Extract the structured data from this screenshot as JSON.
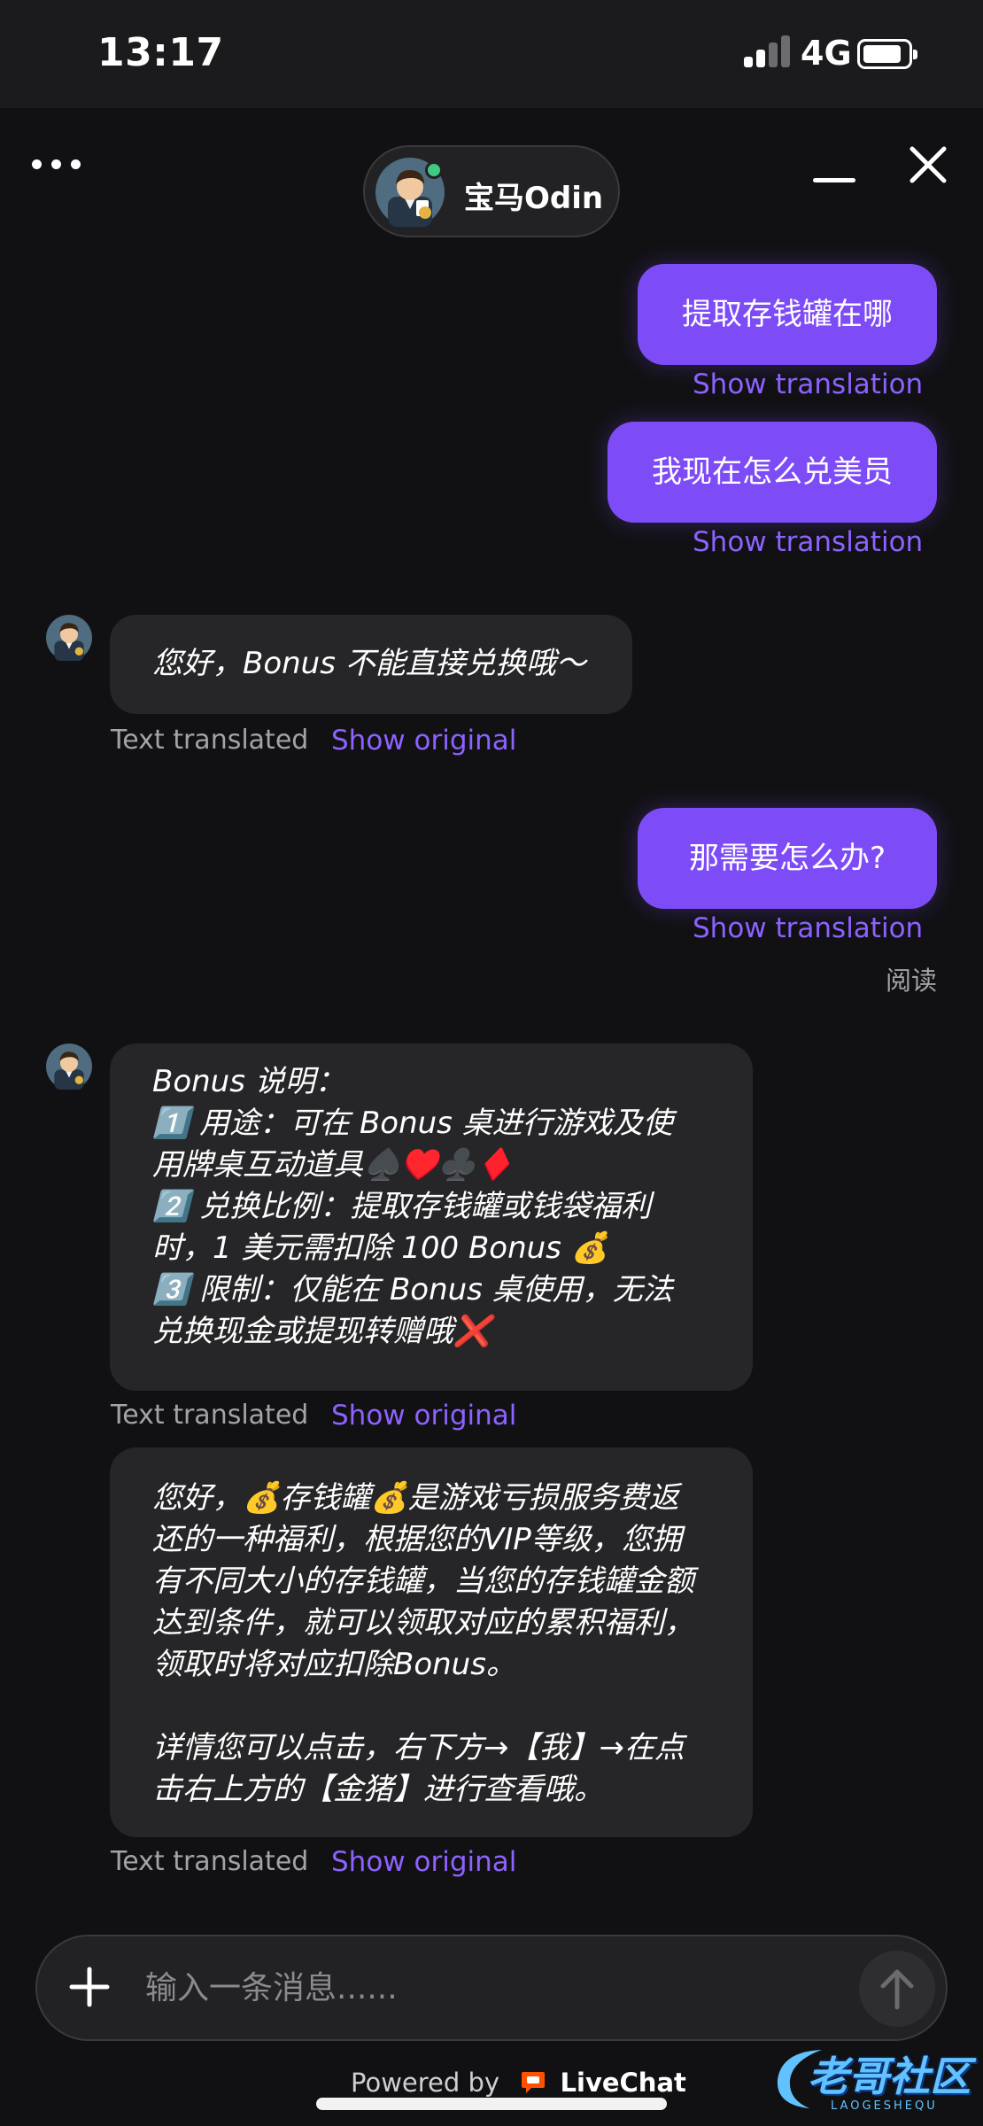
{
  "status_bar": {
    "time": "13:17",
    "network": "4G"
  },
  "header": {
    "agent_name": "宝马Odin"
  },
  "conversation": {
    "out1": {
      "text": "提取存钱罐在哪",
      "link": "Show translation"
    },
    "out2": {
      "text": "我现在怎么兑美员",
      "link": "Show translation"
    },
    "in1": {
      "lines": [
        "您好，Bonus 不能直接兑换哦～"
      ],
      "meta": "Text translated",
      "link": "Show original"
    },
    "out3": {
      "text": "那需要怎么办?",
      "link": "Show translation",
      "receipt": "阅读"
    },
    "in2": {
      "lines": [
        "Bonus 说明：",
        "1️⃣ 用途：可在 Bonus 桌进行游戏及使",
        "用牌桌互动道具♠️♥️♣️♦️",
        "2️⃣ 兑换比例：提取存钱罐或钱袋福利",
        "时，1 美元需扣除 100 Bonus 💰",
        "3️⃣ 限制：仅能在 Bonus 桌使用，无法",
        "兑换现金或提现转赠哦❌"
      ],
      "meta": "Text translated",
      "link": "Show original"
    },
    "in3": {
      "lines": [
        "您好，💰存钱罐💰是游戏亏损服务费返",
        "还的一种福利，根据您的VIP等级，您拥",
        "有不同大小的存钱罐，当您的存钱罐金额",
        "达到条件，就可以领取对应的累积福利，",
        "领取时将对应扣除Bonus。"
      ],
      "lines_b": [
        "详情您可以点击，右下方→【我】→在点",
        "击右上方的【金猪】进行查看哦。"
      ],
      "meta": "Text translated",
      "link": "Show original"
    }
  },
  "composer": {
    "placeholder": "输入一条消息......"
  },
  "footer": {
    "powered_prefix": "Powered by",
    "brand": "LiveChat"
  },
  "watermark": {
    "text": "老哥社区",
    "sub": "LAOGESHEQU"
  },
  "colors": {
    "accent": "#7d4cf7",
    "link": "#8d62ff",
    "background": "#111113",
    "bubble_in": "#262628"
  },
  "icons": [
    "menu-dots-icon",
    "agent-avatar",
    "online-indicator",
    "minimize-icon",
    "close-icon",
    "plus-icon",
    "send-arrow-icon",
    "livechat-logo-icon"
  ]
}
